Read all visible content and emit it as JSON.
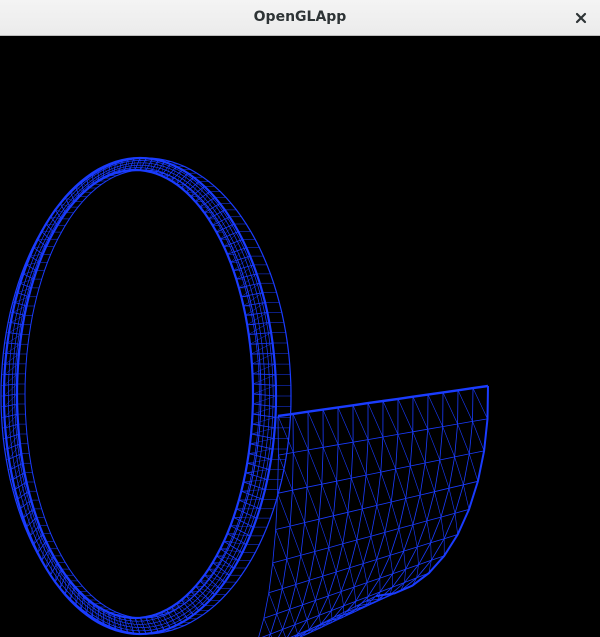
{
  "window": {
    "title": "OpenGLApp",
    "close_icon": "close-icon"
  },
  "viewport": {
    "background_color": "#000000",
    "mesh_color": "#1a3cff",
    "render_mode": "wireframe"
  }
}
